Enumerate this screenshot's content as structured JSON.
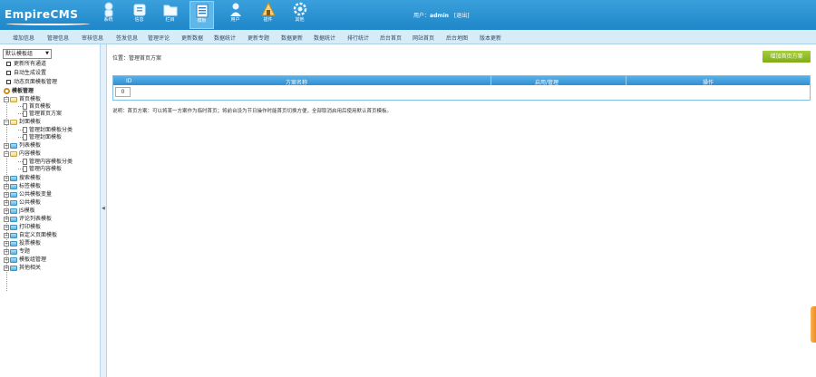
{
  "header": {
    "logo_text": "EmpireCMS",
    "nav": [
      {
        "label": "系统",
        "icon": "system-icon"
      },
      {
        "label": "信息",
        "icon": "info-icon"
      },
      {
        "label": "栏目",
        "icon": "folder-icon"
      },
      {
        "label": "模板",
        "icon": "template-icon"
      },
      {
        "label": "用户",
        "icon": "user-icon"
      },
      {
        "label": "插件",
        "icon": "plugin-icon"
      },
      {
        "label": "其他",
        "icon": "gear-icon"
      }
    ],
    "user_prefix": "用户：",
    "username": "admin",
    "logout_label": "[退出]"
  },
  "menubar": {
    "items": [
      "增加信息",
      "管理信息",
      "审核信息",
      "签发信息",
      "管理评论",
      "更新数据",
      "数据统计",
      "更新专题",
      "数据更新",
      "数据统计",
      "排行统计",
      "后台首页",
      "网站首页",
      "后台地图",
      "版本更新"
    ]
  },
  "sidebar": {
    "select_value": "默认模板组",
    "quick": [
      "更新所有通道",
      "自动生成设置",
      "动态页面模板管理"
    ],
    "root": "模板管理",
    "tree": [
      {
        "label": "首页模板",
        "children": [
          "首页模板",
          "管理首页方案"
        ]
      },
      {
        "label": "封面模板",
        "children": [
          "管理封面模板分类",
          "管理封面模板"
        ]
      },
      {
        "label": "列表模板",
        "children": []
      },
      {
        "label": "内容模板",
        "children": [
          "管理内容模板分类",
          "管理内容模板"
        ]
      },
      {
        "label": "搜索模板",
        "children": []
      },
      {
        "label": "标签模板",
        "children": []
      },
      {
        "label": "公共模板变量",
        "children": []
      },
      {
        "label": "公共模板",
        "children": []
      },
      {
        "label": "JS模板",
        "children": []
      },
      {
        "label": "评论列表模板",
        "children": []
      },
      {
        "label": "打印模板",
        "children": []
      },
      {
        "label": "自定义页面模板",
        "children": []
      },
      {
        "label": "投票模板",
        "children": []
      },
      {
        "label": "专题",
        "children": []
      },
      {
        "label": "模板组管理",
        "children": []
      },
      {
        "label": "其他相关",
        "children": []
      }
    ]
  },
  "main": {
    "breadcrumb": "位置：管理首页方案",
    "add_button": "增加首页方案",
    "columns": [
      "ID",
      "方案名称",
      "启用/管理",
      "操作"
    ],
    "first_row_value": "0",
    "note": "说明：首页方案：可以将某一方案作为临时首页；将前台设为节日操作时能首页切换方便，全部取消启用后使用默认首页模板。"
  }
}
